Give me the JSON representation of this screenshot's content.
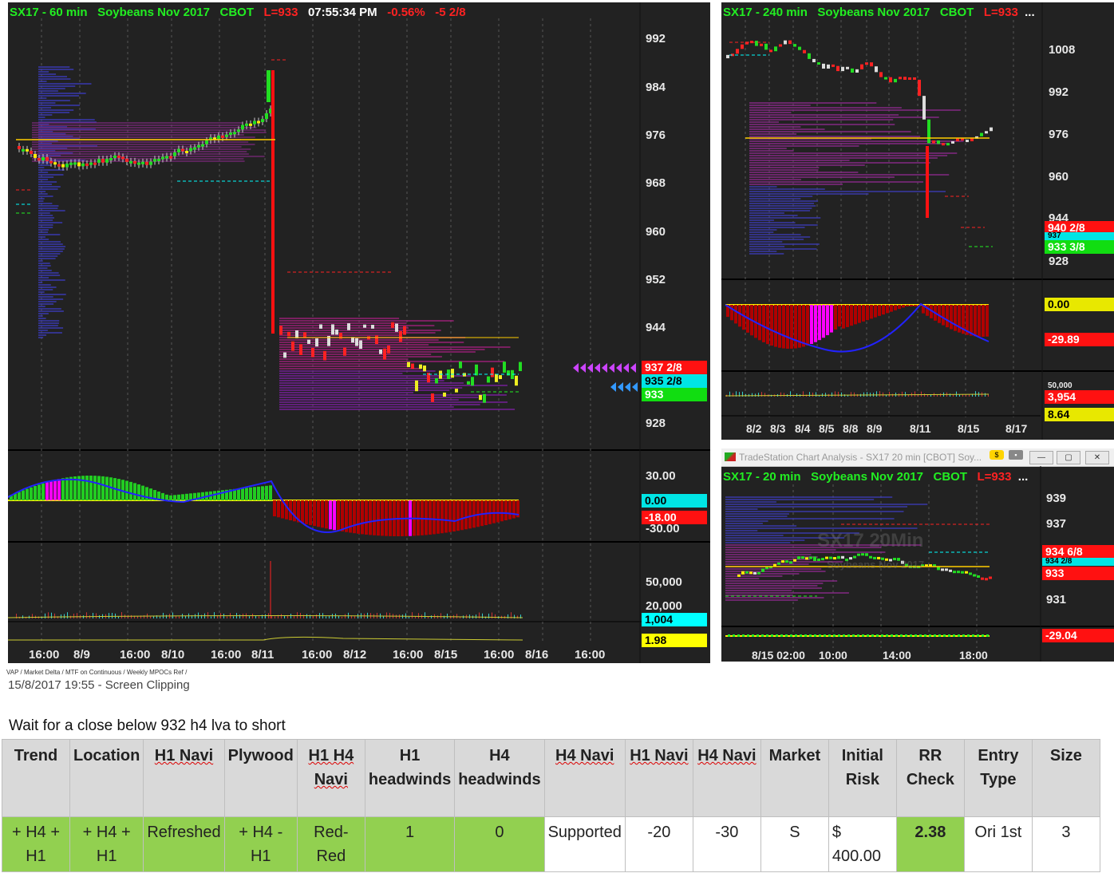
{
  "chart1": {
    "title": {
      "sym": "SX17 - 60 min",
      "desc": "Soybeans Nov 2017",
      "exch": "CBOT",
      "last": "L=933",
      "time": "07:55:34 PM",
      "pct": "-0.56%",
      "chg": "-5 2/8"
    },
    "price_axis": [
      "992",
      "984",
      "976",
      "968",
      "960",
      "952",
      "944",
      "928"
    ],
    "tags": {
      "t1": "937 2/8",
      "t2": "935 2/8",
      "t3": "933"
    },
    "osc_axis": [
      "30.00",
      "-30.00"
    ],
    "osc_tags": {
      "zero": "0.00",
      "val": "-18.00"
    },
    "vol_axis": [
      "50,000",
      "20,000"
    ],
    "vol_tags": {
      "vol": "1,004",
      "ratio": "1.98"
    },
    "time_axis": [
      "16:00",
      "8/9",
      "16:00",
      "8/10",
      "16:00",
      "8/11",
      "16:00",
      "8/12",
      "16:00",
      "8/15",
      "16:00",
      "8/16",
      "16:00"
    ]
  },
  "chart2": {
    "title": {
      "sym": "SX17 - 240 min",
      "desc": "Soybeans Nov 2017",
      "exch": "CBOT",
      "last": "L=933",
      "more": "..."
    },
    "price_axis": [
      "1008",
      "992",
      "976",
      "960",
      "944",
      "928"
    ],
    "tags": {
      "t1": "940 2/8",
      "t2": "937",
      "t3": "933 3/8"
    },
    "osc_tags": {
      "zero": "0.00",
      "val": "-29.89"
    },
    "vol_tags": {
      "top": "50,000",
      "vol": "3,954",
      "ratio": "8.64"
    },
    "time_axis": [
      "8/2",
      "8/3",
      "8/4",
      "8/5",
      "8/8",
      "8/9",
      "8/11",
      "8/15",
      "8/17"
    ]
  },
  "chart3": {
    "window_title": "TradeStation Chart Analysis - SX17 20 min [CBOT] Soy...",
    "title": {
      "sym": "SX17 - 20 min",
      "desc": "Soybeans Nov 2017",
      "exch": "CBOT",
      "last": "L=933",
      "more": "..."
    },
    "watermark": {
      "sym": "SX17 20Min",
      "desc": "Soybeans Nov 2017"
    },
    "price_axis": [
      "939",
      "937",
      "931"
    ],
    "tags": {
      "t1": "934 6/8",
      "t2": "934 2/8",
      "t3": "933"
    },
    "osc_tags": {
      "val": "-29.04"
    },
    "time_axis": [
      "8/15 02:00",
      "10:00",
      "14:00",
      "18:00"
    ]
  },
  "tabs_text": "VAP / Market Delta / MTF on Continuous / Weekly MPOCs Ref /",
  "clipping": "15/8/2017 19:55 - Screen Clipping",
  "note": "Wait for a close below 932 h4 lva to short",
  "journal": {
    "headers": [
      "Trend",
      "Location",
      "H1 Navi",
      "Plywood",
      "H1 H4 Navi",
      "H1 headwinds",
      "H4 headwinds",
      "H4 Navi",
      "H1 Navi",
      "H4 Navi",
      "Market",
      "Initial Risk",
      "RR Check",
      "Entry Type",
      "Size"
    ],
    "row": [
      "+ H4 + H1",
      "+ H4 + H1",
      "Refreshed",
      "+ H4 - H1",
      "Red-Red",
      "1",
      "0",
      "Supported",
      "-20",
      "-30",
      "S",
      "$ 400.00",
      "2.38",
      "Ori 1st",
      "3"
    ]
  },
  "colors": {
    "bg": "#222222",
    "green": "#22ee22",
    "red": "#ff2222",
    "cyan": "#00ffff",
    "yellow": "#ffff00",
    "accent_cell": "#92d050"
  }
}
